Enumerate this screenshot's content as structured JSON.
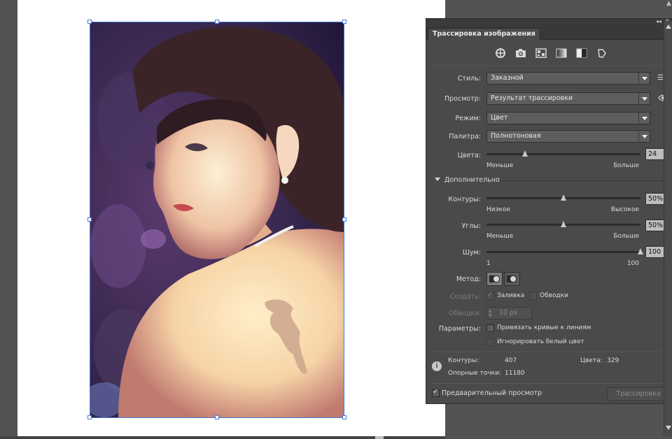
{
  "panel": {
    "title": "Трассировка изображения",
    "presets": [
      "auto-color-icon",
      "high-color-icon",
      "low-color-icon",
      "grayscale-icon",
      "black-white-icon",
      "outline-icon"
    ],
    "style": {
      "label": "Стиль:",
      "value": "Заказной"
    },
    "view": {
      "label": "Просмотр:",
      "value": "Результат трассировки"
    },
    "mode": {
      "label": "Режим:",
      "value": "Цвет"
    },
    "palette": {
      "label": "Палитра:",
      "value": "Полнотоновая"
    },
    "colors": {
      "label": "Цвета:",
      "value": "24",
      "level": 0.25,
      "min_label": "Меньше",
      "max_label": "Больше"
    },
    "advanced": {
      "label": "Дополнительно"
    },
    "paths": {
      "label": "Контуры:",
      "value": "50%",
      "level": 0.5,
      "min_label": "Низкое",
      "max_label": "Высокое"
    },
    "corners": {
      "label": "Углы:",
      "value": "50%",
      "level": 0.5,
      "min_label": "Меньше",
      "max_label": "Больше"
    },
    "noise": {
      "label": "Шум:",
      "value": "100 px",
      "level": 1.0,
      "min_label": "1",
      "max_label": "100"
    },
    "method": {
      "label": "Метод:"
    },
    "create": {
      "label": "Создать:",
      "fill_label": "Заливка",
      "fill_checked": true,
      "stroke_label": "Обводки",
      "stroke_checked": false
    },
    "stroke": {
      "label": "Обводка:",
      "value": "10 px"
    },
    "options": {
      "label": "Параметры:",
      "snap_label": "Привязать кривые к линиям",
      "snap_checked": false,
      "ignore_white_label": "Игнорировать белый цвет",
      "ignore_white_checked": false
    },
    "stats": {
      "paths_label": "Контуры:",
      "paths_value": "407",
      "colors_label": "Цвета:",
      "colors_value": "329",
      "anchors_label": "Опорные точки:",
      "anchors_value": "11180"
    },
    "preview": {
      "label": "Предварительный просмотр",
      "checked": true
    },
    "trace_button": "Трассировка"
  }
}
